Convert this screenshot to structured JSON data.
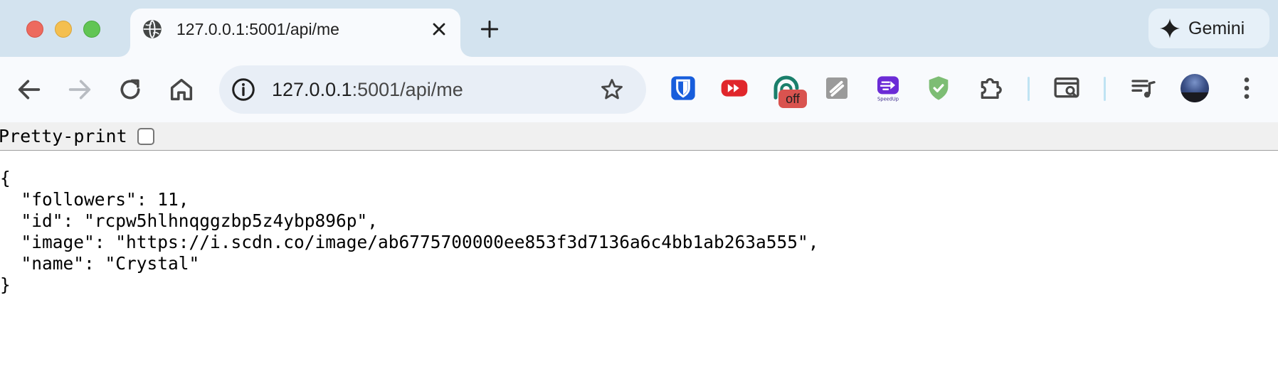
{
  "tab": {
    "title": "127.0.0.1:5001/api/me"
  },
  "gemini": {
    "label": "Gemini"
  },
  "omnibox": {
    "host": "127.0.0.1",
    "path": ":5001/api/me"
  },
  "extensions": {
    "off_badge": "off",
    "speedup_label": "SpeedUp"
  },
  "pretty_print": {
    "label": "Pretty-print",
    "checked": false
  },
  "json_lines": [
    "{",
    "  \"followers\": 11,",
    "  \"id\": \"rcpw5hlhnqggzbp5z4ybp896p\",",
    "  \"image\": \"https://i.scdn.co/image/ab6775700000ee853f3d7136a6c4bb1ab263a555\",",
    "  \"name\": \"Crystal\"",
    "}"
  ],
  "colors": {
    "tabstrip_bg": "#d3e3ef",
    "toolbar_bg": "#f8fafd",
    "omnibox_bg": "#e8eef6",
    "bitwarden_blue": "#175ddc",
    "youtube_red": "#e0262b",
    "off_badge_red": "#d9534f",
    "shield_green": "#7dbd74"
  }
}
